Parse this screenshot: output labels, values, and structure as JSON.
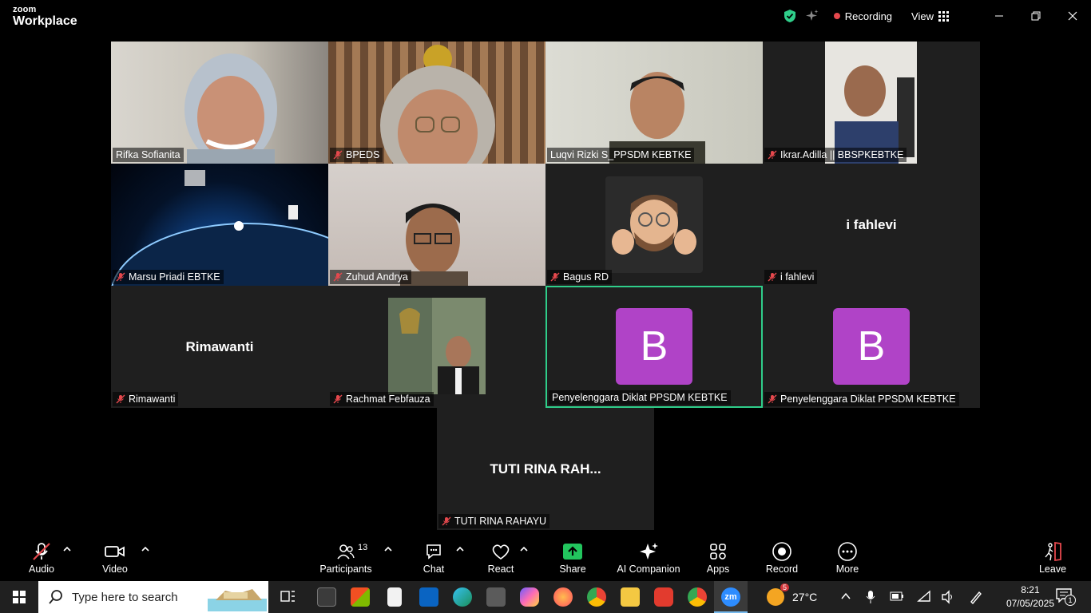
{
  "app": {
    "brand_top": "zoom",
    "brand_bottom": "Workplace"
  },
  "titlebar": {
    "recording_label": "Recording",
    "view_label": "View",
    "accent_shield": "#2fce8a",
    "record_color": "#e5484d"
  },
  "participants": [
    {
      "name": "Rifka Sofianita",
      "muted": false,
      "video": true
    },
    {
      "name": "BPEDS",
      "muted": true,
      "video": true
    },
    {
      "name": "Luqvi Rizki S_PPSDM KEBTKE",
      "muted": false,
      "video": true
    },
    {
      "name": "Ikrar.Adilla || BBSPKEBTKE",
      "muted": true,
      "video": true
    },
    {
      "name": "Marsu Priadi EBTKE",
      "muted": true,
      "video": true
    },
    {
      "name": "Zuhud Andrya",
      "muted": true,
      "video": true
    },
    {
      "name": "Bagus RD",
      "muted": true,
      "video": false
    },
    {
      "name": "i fahlevi",
      "muted": true,
      "video": false,
      "display": "i fahlevi"
    },
    {
      "name": "Rimawanti",
      "muted": true,
      "video": false,
      "display": "Rimawanti"
    },
    {
      "name": "Rachmat Febfauza",
      "muted": true,
      "video": true
    },
    {
      "name": "Penyelenggara Diklat PPSDM KEBTKE",
      "muted": false,
      "video": false,
      "avatar": "B",
      "active_speaker": true
    },
    {
      "name": "Penyelenggara Diklat PPSDM KEBTKE",
      "muted": true,
      "video": false,
      "avatar": "B"
    },
    {
      "name": "TUTI RINA RAHAYU",
      "muted": true,
      "video": false,
      "display": "TUTI RINA RAH..."
    }
  ],
  "toolbar": {
    "audio": "Audio",
    "video": "Video",
    "participants": "Participants",
    "participants_count": "13",
    "chat": "Chat",
    "react": "React",
    "share": "Share",
    "ai_companion": "AI Companion",
    "apps": "Apps",
    "record": "Record",
    "more": "More",
    "leave": "Leave",
    "share_color": "#22c55e",
    "leave_color": "#e5484d"
  },
  "taskbar": {
    "search_placeholder": "Type here to search",
    "weather_temp": "27°C",
    "weather_badge": "5",
    "time": "8:21",
    "date": "07/05/2025",
    "notifications": "1"
  }
}
